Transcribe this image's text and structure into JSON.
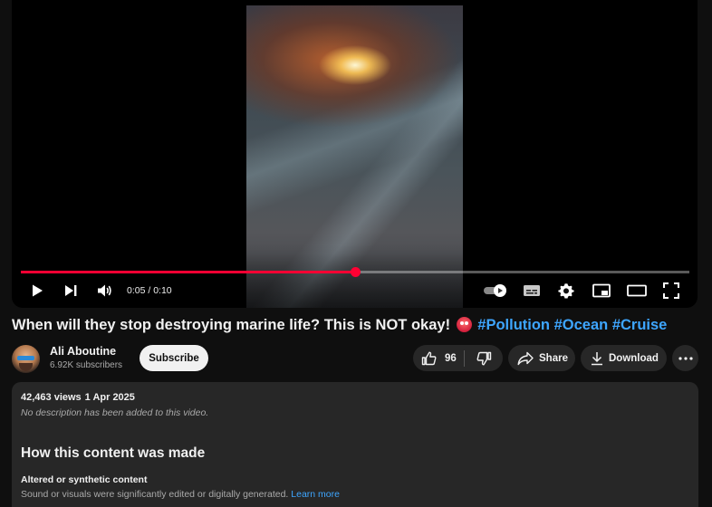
{
  "player": {
    "time_current": "0:05",
    "time_total": "0:10",
    "time_sep": " / ",
    "progress_fraction": 0.5,
    "controls": [
      "play-icon",
      "next-icon",
      "volume-icon",
      "autoplay-toggle-icon",
      "captions-icon",
      "settings-icon",
      "miniplayer-icon",
      "theater-mode-icon",
      "fullscreen-icon"
    ]
  },
  "video": {
    "title": "When will they stop destroying marine life? This is NOT okay!",
    "hashtags": [
      "#Pollution",
      "#Ocean",
      "#Cruise"
    ]
  },
  "channel": {
    "name": "Ali Aboutine",
    "subscribers": "6.92K subscribers",
    "subscribe_label": "Subscribe"
  },
  "actions": {
    "like_count": "96",
    "share_label": "Share",
    "download_label": "Download"
  },
  "description": {
    "views": "42,463 views",
    "date": "1 Apr 2025",
    "no_description": "No description has been added to this video.",
    "how_made_heading": "How this content was made",
    "altered_title": "Altered or synthetic content",
    "altered_text": "Sound or visuals were significantly edited or digitally generated.",
    "learn_more": "Learn more"
  },
  "colors": {
    "background": "#0f0f0f",
    "progress": "#ff0033",
    "link": "#3ea6ff",
    "pill": "#272727"
  }
}
